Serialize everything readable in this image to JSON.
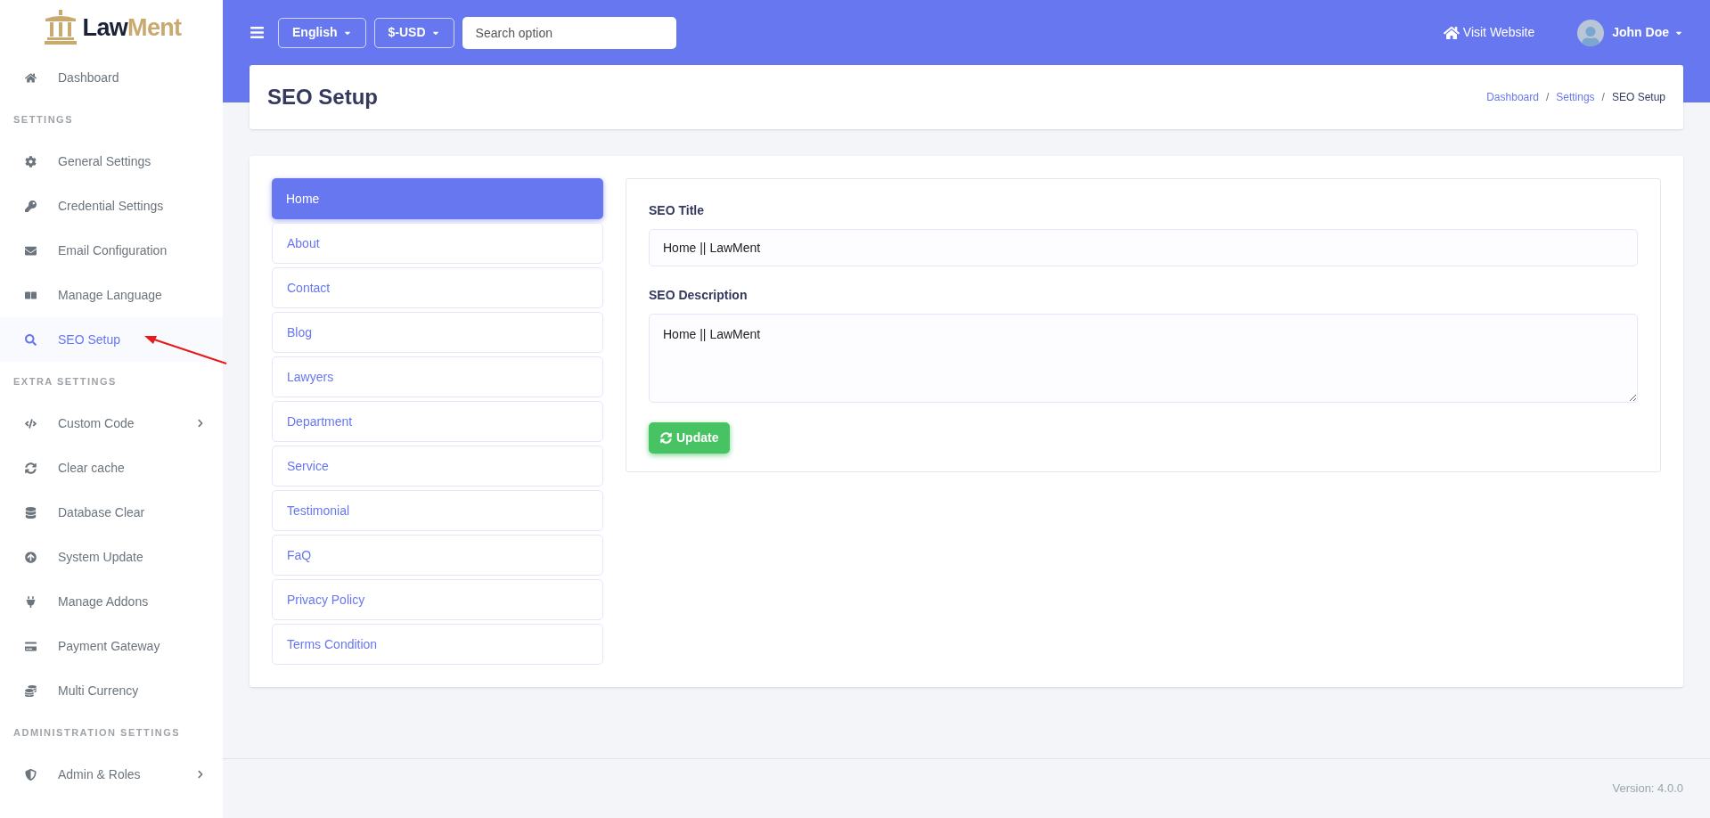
{
  "brand": {
    "part_1": "Law",
    "part_2": "Ment"
  },
  "sidebar": {
    "sections": [
      {
        "items": [
          {
            "label": "Dashboard",
            "selected": false,
            "expandable": false
          }
        ]
      },
      {
        "heading": "SETTINGS",
        "items": [
          {
            "label": "General Settings",
            "selected": false,
            "expandable": false
          },
          {
            "label": "Credential Settings",
            "selected": false,
            "expandable": false
          },
          {
            "label": "Email Configuration",
            "selected": false,
            "expandable": false
          },
          {
            "label": "Manage Language",
            "selected": false,
            "expandable": false
          },
          {
            "label": "SEO Setup",
            "selected": true,
            "expandable": false
          }
        ]
      },
      {
        "heading": "EXTRA SETTINGS",
        "items": [
          {
            "label": "Custom Code",
            "selected": false,
            "expandable": true
          },
          {
            "label": "Clear cache",
            "selected": false,
            "expandable": false
          },
          {
            "label": "Database Clear",
            "selected": false,
            "expandable": false
          },
          {
            "label": "System Update",
            "selected": false,
            "expandable": false
          },
          {
            "label": "Manage Addons",
            "selected": false,
            "expandable": false
          },
          {
            "label": "Payment Gateway",
            "selected": false,
            "expandable": false
          },
          {
            "label": "Multi Currency",
            "selected": false,
            "expandable": false
          }
        ]
      },
      {
        "heading": "ADMINISTRATION SETTINGS",
        "items": [
          {
            "label": "Admin & Roles",
            "selected": false,
            "expandable": true
          }
        ]
      }
    ]
  },
  "topbar": {
    "language": "English",
    "currency": "$-USD",
    "search": {
      "placeholder": "Search option"
    },
    "visit_link": "Visit Website",
    "user": "John Doe"
  },
  "page": {
    "title": "SEO Setup",
    "separator": "/",
    "breadcrumbs": [
      {
        "label": "Dashboard",
        "link": true
      },
      {
        "label": "Settings",
        "link": true
      },
      {
        "label": "SEO Setup",
        "link": false
      }
    ]
  },
  "pages_list": [
    {
      "label": "Home",
      "selected": true
    },
    {
      "label": "About",
      "selected": false
    },
    {
      "label": "Contact",
      "selected": false
    },
    {
      "label": "Blog",
      "selected": false
    },
    {
      "label": "Lawyers",
      "selected": false
    },
    {
      "label": "Department",
      "selected": false
    },
    {
      "label": "Service",
      "selected": false
    },
    {
      "label": "Testimonial",
      "selected": false
    },
    {
      "label": "FaQ",
      "selected": false
    },
    {
      "label": "Privacy Policy",
      "selected": false
    },
    {
      "label": "Terms Condition",
      "selected": false
    }
  ],
  "form": {
    "fields": [
      {
        "label": "SEO Title",
        "kind": "input",
        "value": "Home || LawMent"
      },
      {
        "label": "SEO Description",
        "kind": "textarea",
        "value": "Home || LawMent"
      }
    ],
    "submit": "Update"
  },
  "footer": {
    "version": "Version: 4.0.0"
  }
}
